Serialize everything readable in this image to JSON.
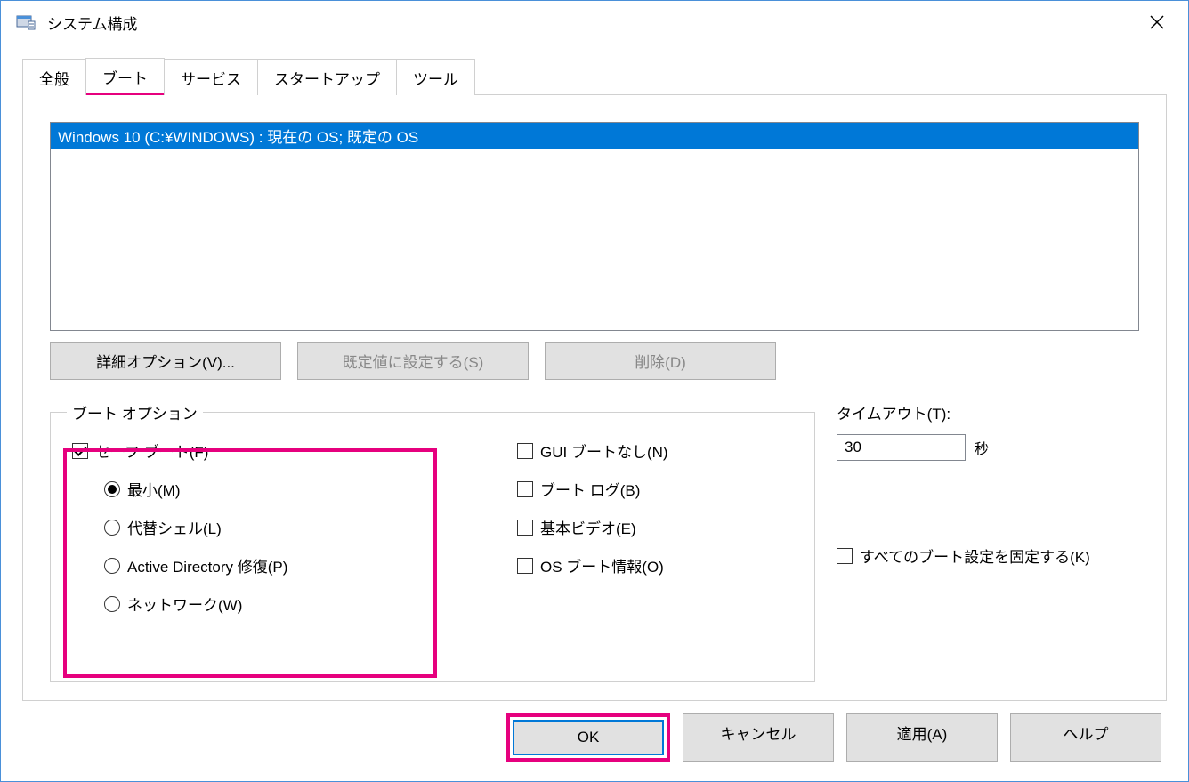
{
  "window": {
    "title": "システム構成"
  },
  "tabs": [
    {
      "label": "全般",
      "active": false
    },
    {
      "label": "ブート",
      "active": true
    },
    {
      "label": "サービス",
      "active": false
    },
    {
      "label": "スタートアップ",
      "active": false
    },
    {
      "label": "ツール",
      "active": false
    }
  ],
  "os_list": {
    "items": [
      "Windows 10 (C:¥WINDOWS) : 現在の OS; 既定の OS"
    ]
  },
  "mid_buttons": {
    "advanced": "詳細オプション(V)...",
    "set_default": "既定値に設定する(S)",
    "delete": "削除(D)"
  },
  "boot_options": {
    "legend": "ブート オプション",
    "safe_boot": {
      "label": "セーフ ブート(F)",
      "checked": true,
      "radios": [
        {
          "label": "最小(M)",
          "checked": true
        },
        {
          "label": "代替シェル(L)",
          "checked": false
        },
        {
          "label": "Active Directory 修復(P)",
          "checked": false
        },
        {
          "label": "ネットワーク(W)",
          "checked": false
        }
      ]
    },
    "right_checks": [
      {
        "label": "GUI ブートなし(N)",
        "checked": false
      },
      {
        "label": "ブート ログ(B)",
        "checked": false
      },
      {
        "label": "基本ビデオ(E)",
        "checked": false
      },
      {
        "label": "OS ブート情報(O)",
        "checked": false
      }
    ]
  },
  "timeout": {
    "label": "タイムアウト(T):",
    "value": "30",
    "unit": "秒"
  },
  "fix_boot_settings": {
    "label": "すべてのブート設定を固定する(K)",
    "checked": false
  },
  "dialog_buttons": {
    "ok": "OK",
    "cancel": "キャンセル",
    "apply": "適用(A)",
    "help": "ヘルプ"
  }
}
